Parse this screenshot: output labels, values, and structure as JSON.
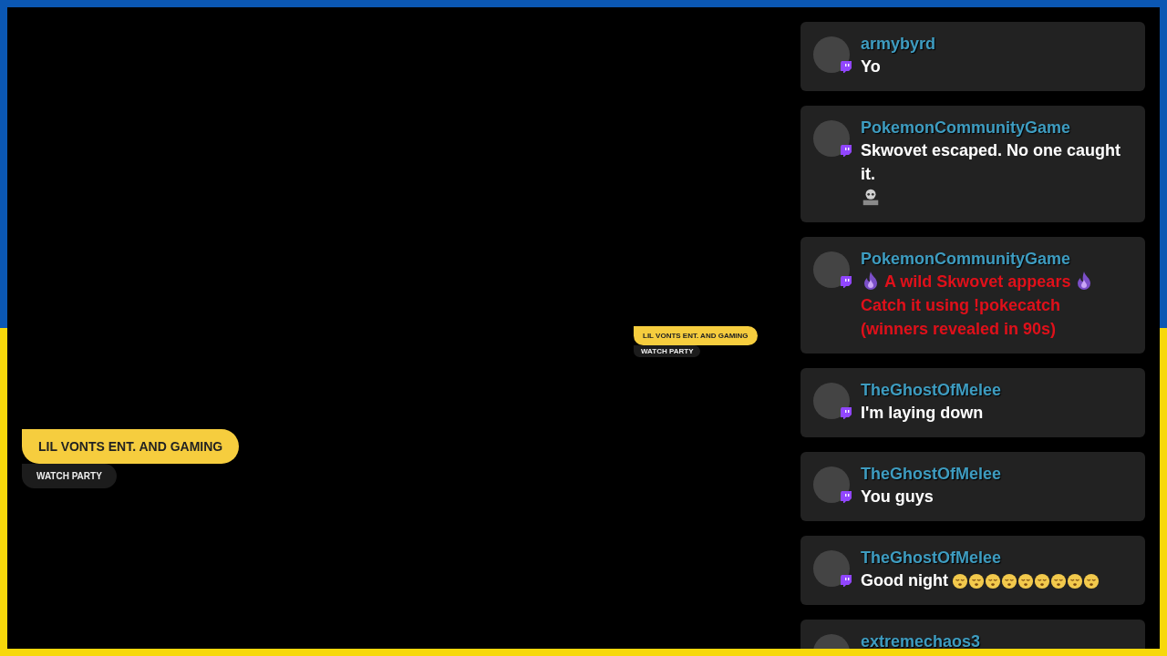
{
  "overlay_titles": [
    {
      "title": "LIL VONTS ENT. AND GAMING",
      "subtitle": "WATCH PARTY"
    },
    {
      "title": "LIL VONTS ENT. AND GAMING",
      "subtitle": "WATCH PARTY"
    }
  ],
  "chat": {
    "messages": [
      {
        "username": "armybyrd",
        "color": "#ffffff",
        "parts": [
          {
            "kind": "text",
            "text": "Yo"
          }
        ]
      },
      {
        "username": "PokemonCommunityGame",
        "color": "#ffffff",
        "parts": [
          {
            "kind": "text",
            "text": "Skwovet escaped. No one caught it."
          },
          {
            "kind": "rigged"
          }
        ]
      },
      {
        "username": "PokemonCommunityGame",
        "color": "#e0101a",
        "parts": [
          {
            "kind": "flame"
          },
          {
            "kind": "text",
            "text": "A wild Skwovet appears"
          },
          {
            "kind": "flame"
          },
          {
            "kind": "text",
            "text": "Catch it using !pokecatch (winners revealed in 90s)"
          }
        ]
      },
      {
        "username": "TheGhostOfMelee",
        "color": "#ffffff",
        "parts": [
          {
            "kind": "text",
            "text": "I'm laying down"
          }
        ]
      },
      {
        "username": "TheGhostOfMelee",
        "color": "#ffffff",
        "parts": [
          {
            "kind": "text",
            "text": "You guys"
          }
        ]
      },
      {
        "username": "TheGhostOfMelee",
        "color": "#ffffff",
        "parts": [
          {
            "kind": "text",
            "text": "Good night"
          },
          {
            "kind": "sleepy"
          },
          {
            "kind": "sleepy"
          },
          {
            "kind": "sleepy"
          },
          {
            "kind": "sleepy"
          },
          {
            "kind": "sleepy"
          },
          {
            "kind": "sleepy"
          },
          {
            "kind": "sleepy"
          },
          {
            "kind": "sleepy"
          },
          {
            "kind": "sleepy"
          }
        ]
      },
      {
        "username": "extremechaos3"
      }
    ]
  }
}
